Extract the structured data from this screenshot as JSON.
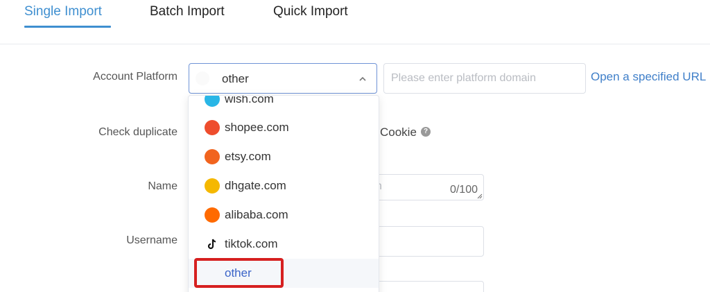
{
  "tabs": [
    {
      "label": "Single Import"
    },
    {
      "label": "Batch Import"
    },
    {
      "label": "Quick Import"
    }
  ],
  "form": {
    "account_platform": {
      "label": "Account Platform",
      "selected": "other",
      "domain_placeholder": "Please enter platform domain",
      "link": "Open a specified URL"
    },
    "check_duplicate_label": "Check duplicate",
    "cookie_label": "Cookie",
    "help_glyph": "?",
    "name": {
      "label": "Name",
      "counter": "0/100"
    },
    "username": {
      "label": "Username"
    }
  },
  "dropdown": {
    "options": [
      {
        "label": "wish.com",
        "icon": "wish-icon",
        "color": "#29b6e6"
      },
      {
        "label": "shopee.com",
        "icon": "shopee-icon",
        "color": "#ee4d2d"
      },
      {
        "label": "etsy.com",
        "icon": "etsy-icon",
        "color": "#f1641e"
      },
      {
        "label": "dhgate.com",
        "icon": "dhgate-icon",
        "color": "#f5b800"
      },
      {
        "label": "alibaba.com",
        "icon": "alibaba-icon",
        "color": "#ff6a00"
      },
      {
        "label": "tiktok.com",
        "icon": "tiktok-icon",
        "color": "#111111"
      },
      {
        "label": "other",
        "selected": true
      }
    ]
  },
  "colors": {
    "accent": "#3f8fd0",
    "link": "#3f7fc9",
    "selected_option": "#3b64c8",
    "highlight": "#d62020"
  }
}
